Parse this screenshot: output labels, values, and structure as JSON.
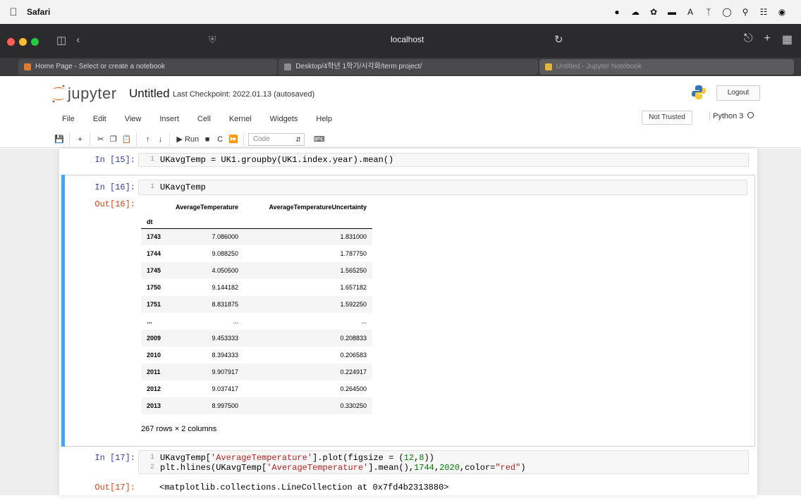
{
  "menubar": {
    "app": "Safari",
    "items": [
      "",
      "",
      "",
      "",
      "",
      "",
      ""
    ],
    "clock": ""
  },
  "safari": {
    "address": "localhost",
    "tabs": [
      {
        "label": "Home Page - Select or create a notebook"
      },
      {
        "label": "Desktop/4학년 1학기/시각화/term project/"
      },
      {
        "label": "Untitled - Jupyter Notebook"
      }
    ]
  },
  "jupyter": {
    "brand": "jupyter",
    "title": "Untitled",
    "checkpoint": "Last Checkpoint: 2022.01.13  (autosaved)",
    "logout": "Logout",
    "menu": [
      "File",
      "Edit",
      "View",
      "Insert",
      "Cell",
      "Kernel",
      "Widgets",
      "Help"
    ],
    "not_trusted": "Not Trusted",
    "kernel": "Python 3",
    "toolbar": {
      "run": "Run",
      "celltype": "Code"
    }
  },
  "cells": [
    {
      "prompt": "In [15]:",
      "lines": [
        "UKavgTemp = UK1.groupby(UK1.index.year).mean()"
      ]
    },
    {
      "prompt": "In [16]:",
      "out_prompt": "Out[16]:",
      "lines": [
        "UKavgTemp"
      ]
    },
    {
      "prompt": "In [17]:",
      "out_prompt": "Out[17]:",
      "line1_a": "UKavgTemp[",
      "line1_str": "'AverageTemperature'",
      "line1_b": "].plot(figsize = (",
      "line1_n1": "12",
      "line1_c": ",",
      "line1_n2": "8",
      "line1_d": "))",
      "line2_a": "plt.hlines(UKavgTemp[",
      "line2_str": "'AverageTemperature'",
      "line2_b": "].mean(),",
      "line2_n1": "1744",
      "line2_c": ",",
      "line2_n2": "2020",
      "line2_d": ",color=",
      "line2_str2": "\"red\"",
      "line2_e": ")",
      "output": "<matplotlib.collections.LineCollection at 0x7fd4b2313880>"
    }
  ],
  "dataframe": {
    "columns": [
      "AverageTemperature",
      "AverageTemperatureUncertainty"
    ],
    "index_name": "dt",
    "rows": [
      {
        "idx": "1743",
        "a": "7.086000",
        "b": "1.831000"
      },
      {
        "idx": "1744",
        "a": "9.088250",
        "b": "1.787750"
      },
      {
        "idx": "1745",
        "a": "4.050500",
        "b": "1.565250"
      },
      {
        "idx": "1750",
        "a": "9.144182",
        "b": "1.657182"
      },
      {
        "idx": "1751",
        "a": "8.831875",
        "b": "1.592250"
      },
      {
        "idx": "...",
        "a": "...",
        "b": "..."
      },
      {
        "idx": "2009",
        "a": "9.453333",
        "b": "0.208833"
      },
      {
        "idx": "2010",
        "a": "8.394333",
        "b": "0.206583"
      },
      {
        "idx": "2011",
        "a": "9.907917",
        "b": "0.224917"
      },
      {
        "idx": "2012",
        "a": "9.037417",
        "b": "0.264500"
      },
      {
        "idx": "2013",
        "a": "8.997500",
        "b": "0.330250"
      }
    ],
    "footer": "267 rows × 2 columns"
  },
  "colors": {
    "accent_cell": "#42a5f5",
    "in_prompt": "#303f9f",
    "out_prompt": "#d84315"
  },
  "icons": [
    "apple-icon",
    "sidebar-icon",
    "back-icon",
    "shield-icon",
    "reload-icon",
    "share-icon",
    "new-tab-icon",
    "tabs-overview-icon",
    "jupyter-logo-icon",
    "python-logo-icon",
    "save-icon",
    "add-cell-icon",
    "cut-icon",
    "copy-icon",
    "paste-icon",
    "move-up-icon",
    "move-down-icon",
    "run-icon",
    "stop-icon",
    "restart-icon",
    "fast-forward-icon",
    "keyboard-icon"
  ]
}
